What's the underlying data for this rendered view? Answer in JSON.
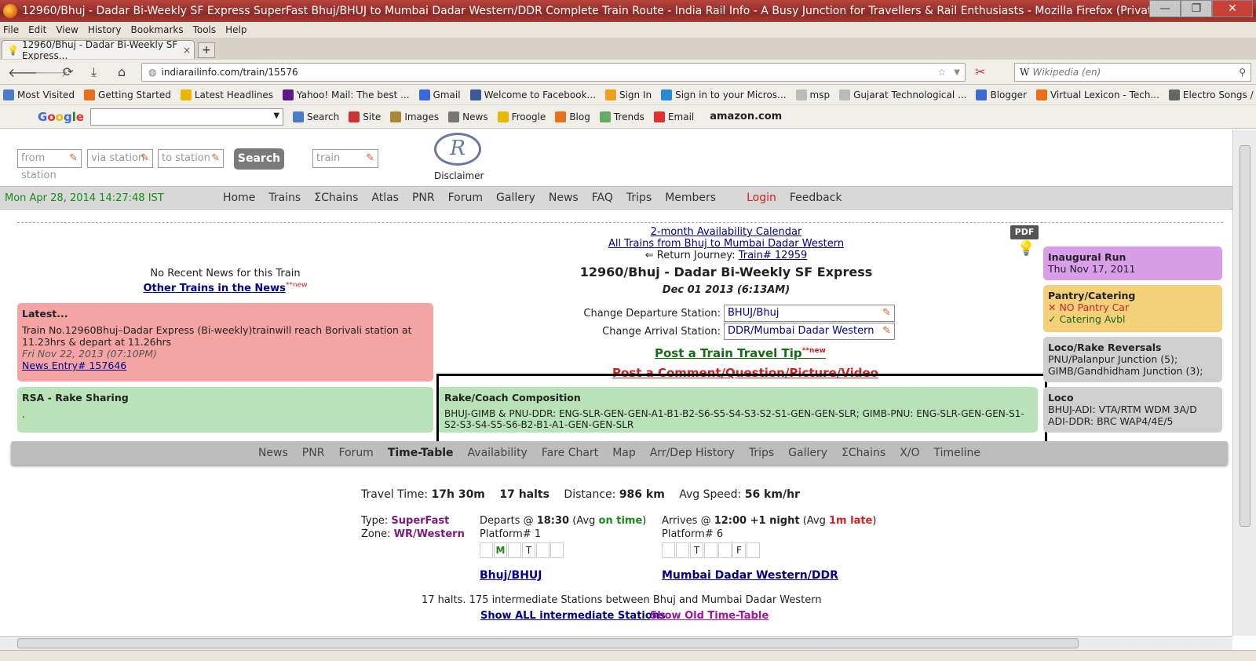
{
  "window": {
    "title": "12960/Bhuj - Dadar Bi-Weekly SF Express SuperFast Bhuj/BHUJ to Mumbai Dadar Western/DDR Complete Train Route - India Rail Info - A Busy Junction for Travellers & Rail Enthusiasts - Mozilla Firefox (Private Browsing)",
    "minimize": "—",
    "restore": "❐",
    "close": "✕"
  },
  "menu": [
    "File",
    "Edit",
    "View",
    "History",
    "Bookmarks",
    "Tools",
    "Help"
  ],
  "tab": {
    "label": "12960/Bhuj - Dadar Bi-Weekly SF Express...",
    "close": "×",
    "new": "+"
  },
  "url": "indiarailinfo.com/train/15576",
  "search_placeholder": "Wikipedia (en)",
  "bookmarks": [
    {
      "label": "Most Visited",
      "color": "#4a7ac8"
    },
    {
      "label": "Getting Started",
      "color": "#e8701a"
    },
    {
      "label": "Latest Headlines",
      "color": "#e8b800"
    },
    {
      "label": "Yahoo! Mail: The best ...",
      "color": "#5a1a8a"
    },
    {
      "label": "Gmail",
      "color": "#3a6ad8"
    },
    {
      "label": "Welcome to Facebook...",
      "color": "#3b5998"
    },
    {
      "label": "Sign In",
      "color": "#f0a020"
    },
    {
      "label": "Sign in to your Micros...",
      "color": "#2a8ad8"
    },
    {
      "label": "msp",
      "color": "#bbbbbb"
    },
    {
      "label": "Gujarat Technological ...",
      "color": "#bbbbbb"
    },
    {
      "label": "Blogger",
      "color": "#3a6ad8"
    },
    {
      "label": "Virtual Lexicon - Tech...",
      "color": "#e8701a"
    },
    {
      "label": "Electro Songs / House ...",
      "color": "#666666"
    }
  ],
  "google_toolbar": {
    "logo": "Google",
    "items": [
      "Search",
      "Site",
      "Images",
      "News",
      "Froogle",
      "Blog",
      "Trends",
      "Email"
    ],
    "amazon": "amazon.com"
  },
  "searchform": {
    "from": "from station",
    "via": "via station",
    "to": "to station",
    "button": "Search",
    "train": "train",
    "logo": "R",
    "disclaimer": "Disclaimer"
  },
  "sitenav": {
    "datetime": "Mon Apr 28, 2014 14:27:48 IST",
    "items": [
      "Home",
      "Trains",
      "ΣChains",
      "Atlas",
      "PNR",
      "Forum",
      "Gallery",
      "News",
      "FAQ",
      "Trips",
      "Members"
    ],
    "login": "Login",
    "feedback": "Feedback"
  },
  "left": {
    "no_news": "No Recent News for this Train",
    "other_trains": "Other Trains in the News",
    "new_tag": "**new",
    "latest_title": "Latest...",
    "latest_text": "Train No.12960Bhuj–Dadar Express (Bi-weekly)trainwill reach Borivali station at 11.23hrs & depart at 11.26hrs",
    "latest_date": "Fri Nov 22, 2013 (07:10PM)",
    "news_entry": "News Entry# 157646",
    "rsa_title": "RSA - Rake Sharing",
    "rsa_text": "."
  },
  "center": {
    "calendar": "2-month Availability Calendar",
    "all_trains": "All Trains from Bhuj to Mumbai Dadar Western",
    "return_label": "⇐ Return Journey:",
    "return_train": "Train# 12959",
    "train_title": "12960/Bhuj - Dadar Bi-Weekly SF Express",
    "date": "Dec 01 2013 (6:13AM)",
    "dep_label": "Change Departure Station:",
    "dep_value": "BHUJ/Bhuj",
    "arr_label": "Change Arrival Station:",
    "arr_value": "DDR/Mumbai Dadar Western",
    "tip": "Post a Train Travel Tip",
    "new_tag": "**new",
    "post": "Post a Comment/Question/Picture/Video"
  },
  "rake": {
    "title": "Rake/Coach Composition",
    "text": "BHUJ-GIMB & PNU-DDR: ENG-SLR-GEN-GEN-A1-B1-B2-S6-S5-S4-S3-S2-S1-GEN-GEN-SLR; GIMB-PNU: ENG-SLR-GEN-GEN-S1-S2-S3-S4-S5-S6-B2-B1-A1-GEN-GEN-SLR"
  },
  "right": {
    "pdf": "PDF",
    "inaug_title": "Inaugural Run",
    "inaug_date": "Thu Nov 17, 2011",
    "pantry_title": "Pantry/Catering",
    "pantry_no": "✕ NO Pantry Car",
    "pantry_yes": "✓ Catering Avbl",
    "locorake_title": "Loco/Rake Reversals",
    "locorake_1": "PNU/Palanpur Junction (5);",
    "locorake_2": "GIMB/Gandhidham Junction (3);",
    "loco_title": "Loco",
    "loco_1": "BHUJ-ADI: VTA/RTM WDM 3A/D",
    "loco_2": "ADI-DDR: BRC WAP4/4E/5"
  },
  "subnav": [
    "News",
    "PNR",
    "Forum",
    "Time-Table",
    "Availability",
    "Fare Chart",
    "Map",
    "Arr/Dep History",
    "Trips",
    "Gallery",
    "ΣChains",
    "X/O",
    "Timeline"
  ],
  "schedule": {
    "travel_label": "Travel Time:",
    "travel": "17h 30m",
    "halts_val": "17 halts",
    "distance_label": "Distance:",
    "distance": "986 km",
    "speed_label": "Avg Speed:",
    "speed": "56 km/hr",
    "type_label": "Type:",
    "type": "SuperFast",
    "zone_label": "Zone:",
    "zone": "WR/Western",
    "dep_label": "Departs @",
    "dep_time": "18:30",
    "dep_avg_pre": "(Avg",
    "dep_avg": "on time",
    "dep_avg_post": ")",
    "dep_platform": "Platform# 1",
    "dep_days": [
      "",
      "M",
      "",
      "T",
      "",
      ""
    ],
    "dep_station": "Bhuj/BHUJ",
    "arr_label": "Arrives @",
    "arr_time": "12:00 +1 night",
    "arr_avg_pre": "(Avg",
    "arr_avg": "1m late",
    "arr_avg_post": ")",
    "arr_platform": "Platform# 6",
    "arr_days": [
      "",
      "",
      "T",
      "",
      "",
      "F",
      ""
    ],
    "arr_station": "Mumbai Dadar Western/DDR",
    "halts_text": "17 halts. 175 intermediate Stations between Bhuj and Mumbai Dadar Western",
    "show_all": "Show ALL intermediate Stations",
    "show_old": "Show Old Time-Table"
  }
}
